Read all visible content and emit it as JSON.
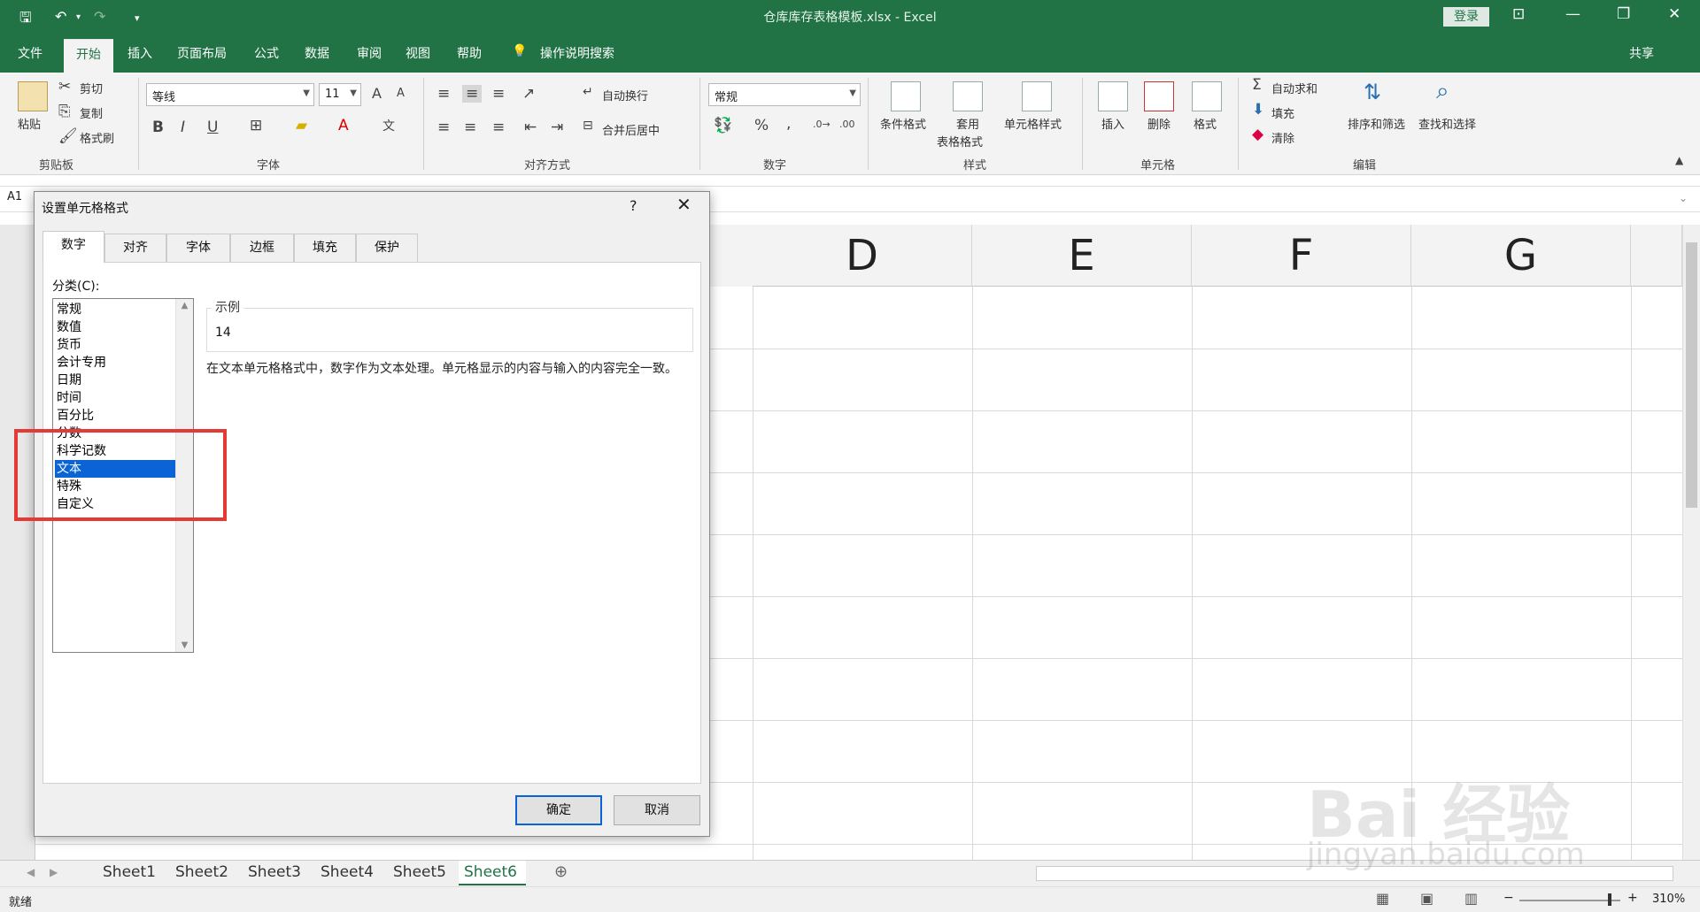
{
  "window": {
    "title": "仓库库存表格模板.xlsx  -  Excel",
    "login_label": "登录",
    "share_label": "共享"
  },
  "ribbon_tabs": [
    {
      "label": "文件"
    },
    {
      "label": "开始"
    },
    {
      "label": "插入"
    },
    {
      "label": "页面布局"
    },
    {
      "label": "公式"
    },
    {
      "label": "数据"
    },
    {
      "label": "审阅"
    },
    {
      "label": "视图"
    },
    {
      "label": "帮助"
    },
    {
      "label": "操作说明搜索"
    }
  ],
  "clipboard": {
    "paste": "粘贴",
    "cut": "剪切",
    "copy": "复制",
    "format_painter": "格式刷",
    "title": "剪贴板"
  },
  "font": {
    "name": "等线",
    "size": "11",
    "title": "字体",
    "bold": "B",
    "italic": "I",
    "underline": "U",
    "grow": "A",
    "shrink": "A"
  },
  "alignment": {
    "wrap": "自动换行",
    "merge": "合并后居中",
    "title": "对齐方式"
  },
  "number": {
    "format": "常规",
    "percent": "%",
    "comma": ",",
    "title": "数字"
  },
  "styles": {
    "conditional": "条件格式",
    "table_line1": "套用",
    "table_line2": "表格格式",
    "cell_styles": "单元格样式",
    "title": "样式"
  },
  "cells": {
    "insert": "插入",
    "delete": "删除",
    "format": "格式",
    "title": "单元格"
  },
  "editing": {
    "autosum": "自动求和",
    "fill": "填充",
    "clear": "清除",
    "sort": "排序和筛选",
    "find": "查找和选择",
    "title": "编辑"
  },
  "formula_bar": {
    "name_box": "A1"
  },
  "columns": [
    "D",
    "E",
    "F",
    "G"
  ],
  "sheets": [
    "Sheet1",
    "Sheet2",
    "Sheet3",
    "Sheet4",
    "Sheet5",
    "Sheet6"
  ],
  "active_sheet": "Sheet6",
  "status": {
    "ready": "就绪",
    "zoom": "310%",
    "minus": "−",
    "plus": "+"
  },
  "dialog": {
    "title": "设置单元格格式",
    "help": "?",
    "close": "✕",
    "tabs": [
      "数字",
      "对齐",
      "字体",
      "边框",
      "填充",
      "保护"
    ],
    "category_label": "分类(C):",
    "categories": [
      "常规",
      "数值",
      "货币",
      "会计专用",
      "日期",
      "时间",
      "百分比",
      "分数",
      "科学记数",
      "文本",
      "特殊",
      "自定义"
    ],
    "selected_category": "文本",
    "sample_label": "示例",
    "sample_value": "14",
    "description": "在文本单元格格式中，数字作为文本处理。单元格显示的内容与输入的内容完全一致。",
    "ok": "确定",
    "cancel": "取消"
  },
  "watermark": {
    "brand": "Bai 经验",
    "url": "jingyan.baidu.com"
  },
  "colors": {
    "excel_green": "#217346",
    "selection_blue": "#0a64d6",
    "highlight_red": "#e53935"
  }
}
